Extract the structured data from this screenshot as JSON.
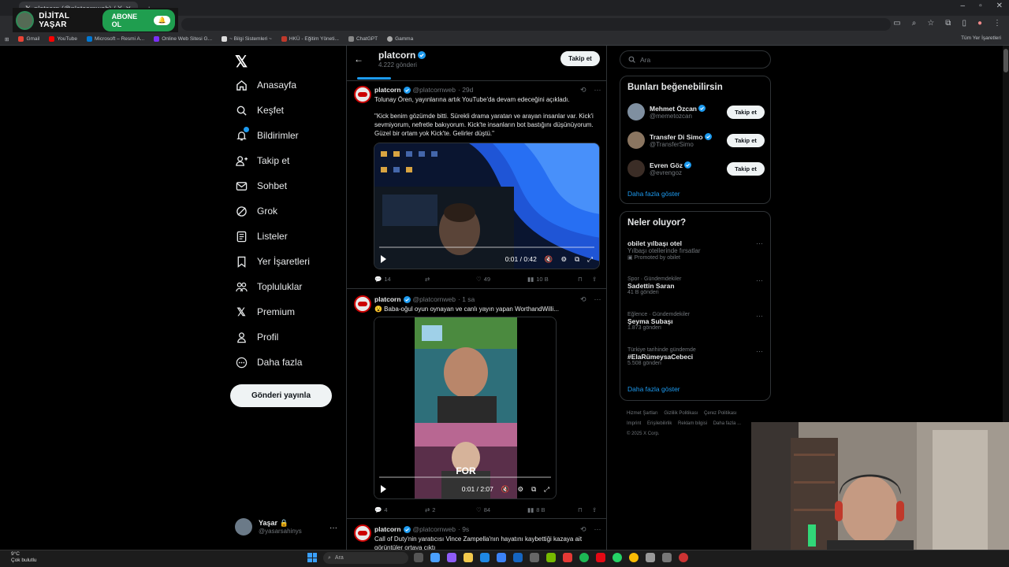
{
  "channel_overlay": {
    "name": "DİJİTAL YAŞAR",
    "subscribe": "ABONE OL"
  },
  "browser": {
    "bookmarks": [
      "Gmail",
      "YouTube",
      "Microsoft – Resmi A...",
      "Online Web Sitesi G...",
      "~ Bilgi Sistemleri ~",
      "HKÜ - Eğitim Yöneti...",
      "ChatGPT",
      "Gamma"
    ],
    "all_bookmarks": "Tüm Yer İşaretleri"
  },
  "nav": {
    "items": [
      "Anasayfa",
      "Keşfet",
      "Bildirimler",
      "Takip et",
      "Sohbet",
      "Grok",
      "Listeler",
      "Yer İşaretleri",
      "Topluluklar",
      "Premium",
      "Profil",
      "Daha fazla"
    ],
    "post_button": "Gönderi yayınla",
    "user_name": "Yaşar",
    "user_handle": "@yasarsahinys"
  },
  "profile": {
    "name": "platcorn",
    "posts": "4.222 gönderi",
    "follow": "Takip et"
  },
  "tweets": [
    {
      "name": "platcorn",
      "handle": "@platcornweb",
      "time": "· 29d",
      "text1": "Tolunay Ören, yayınlarına artık YouTube'da devam edeceğini açıkladı.",
      "text2": "\"Kick benim gözümde bitti. Sürekli drama yaratan ve arayan insanlar var. Kick'i sevmiyorum, nefretle bakıyorum. Kick'te insanların bot bastığını düşünüyorum. Güzel bir ortam yok Kick'te. Gelirler düştü.\"",
      "video_time": "0:01 / 0:42",
      "replies": "14",
      "likes": "49",
      "views": "10 B"
    },
    {
      "name": "platcorn",
      "handle": "@platcornweb",
      "time": "· 1 sa",
      "text1": "😮 Baba-oğul oyun oynayan ve canlı yayın yapan WorthandWilli...",
      "video_time": "0:01 / 2:07",
      "video_caption": "FOR",
      "replies": "4",
      "reposts": "2",
      "likes": "84",
      "views": "8 B"
    },
    {
      "name": "platcorn",
      "handle": "@platcornweb",
      "time": "· 9s",
      "text1": "Call of Duty'nin yaratıcısı Vince Zampella'nın hayatını kaybettiği kazaya ait görüntüler ortaya çıktı"
    }
  ],
  "sidebar": {
    "search_placeholder": "Ara",
    "suggest_title": "Bunları beğenebilirsin",
    "suggestions": [
      {
        "name": "Mehmet Özcan",
        "handle": "@memetozcan",
        "btn": "Takip et"
      },
      {
        "name": "Transfer Di Simo",
        "handle": "@TransferSimo",
        "btn": "Takip et"
      },
      {
        "name": "Evren Göz",
        "handle": "@evrengoz",
        "btn": "Takip et"
      }
    ],
    "show_more": "Daha fazla göster",
    "trends_title": "Neler oluyor?",
    "trends": [
      {
        "cat": "",
        "title": "obilet yılbaşı otel",
        "posts": "Yılbaşı otellerinde fırsatlar",
        "promo": "Promoted by obilet"
      },
      {
        "cat": "Spor · Gündemdekiler",
        "title": "Sadettin Saran",
        "posts": "41 B gönderi"
      },
      {
        "cat": "Eğlence · Gündemdekiler",
        "title": "Şeyma Subaşı",
        "posts": "1.873 gönderi"
      },
      {
        "cat": "Türkiye tarihinde gündemde",
        "title": "#ElaRümeysaCebeci",
        "posts": "5.508 gönderi"
      }
    ],
    "trends_more": "Daha fazla göster",
    "footer": [
      "Hizmet Şartları",
      "Gizlilik Politikası",
      "Çerez Politikası",
      "Imprint",
      "Erişilebilirlik",
      "Reklam bilgisi",
      "Daha fazla ...",
      "© 2025 X Corp."
    ]
  },
  "taskbar": {
    "temp": "9°C",
    "weather": "Çok bulutlu",
    "search": "Ara"
  }
}
